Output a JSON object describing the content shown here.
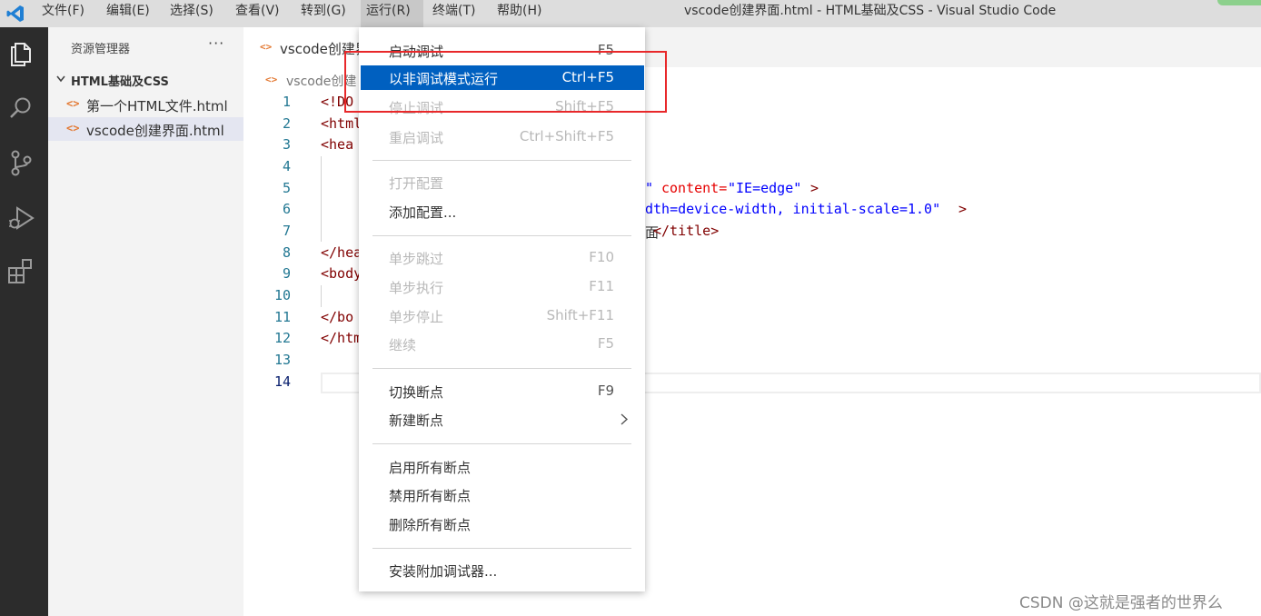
{
  "window": {
    "title": "vscode创建界面.html - HTML基础及CSS - Visual Studio Code"
  },
  "menubar": {
    "items": [
      {
        "label": "文件(F)"
      },
      {
        "label": "编辑(E)"
      },
      {
        "label": "选择(S)"
      },
      {
        "label": "查看(V)"
      },
      {
        "label": "转到(G)"
      },
      {
        "label": "运行(R)"
      },
      {
        "label": "终端(T)"
      },
      {
        "label": "帮助(H)"
      }
    ]
  },
  "activitybar": {
    "icons": [
      "files-icon",
      "search-icon",
      "source-control-icon",
      "run-debug-icon",
      "extensions-icon"
    ]
  },
  "sidebar": {
    "title": "资源管理器",
    "more": "···",
    "folder": "HTML基础及CSS",
    "files": [
      {
        "name": "第一个HTML文件.html",
        "icon": "<>"
      },
      {
        "name": "vscode创建界面.html",
        "icon": "<>"
      }
    ]
  },
  "editor": {
    "tab_label": "vscode创建界",
    "tab_icon": "<>",
    "breadcrumb_label": "vscode创建",
    "breadcrumb_icon": "<>",
    "line_numbers": [
      "1",
      "2",
      "3",
      "4",
      "5",
      "6",
      "7",
      "8",
      "9",
      "10",
      "11",
      "12",
      "13",
      "14"
    ],
    "code": {
      "l1": "<!DO",
      "l2": "<html",
      "l3": "<hea",
      "l5_quote": "\"",
      "l5_attr": "content=",
      "l5_val": "\"IE=edge\"",
      "l5_end": ">",
      "l6_val": "dth=device-width, initial-scale=1.0\"",
      "l6_end": ">",
      "l7_char": "面",
      "l7_end": "</title>",
      "l8": "</hea",
      "l9": "<body",
      "l11": "</bo",
      "l12": "</htm"
    }
  },
  "run_menu": {
    "items": [
      {
        "label": "启动调试",
        "shortcut": "F5",
        "state": "normal"
      },
      {
        "label": "以非调试模式运行",
        "shortcut": "Ctrl+F5",
        "state": "highlighted"
      },
      {
        "label": "停止调试",
        "shortcut": "Shift+F5",
        "state": "disabled"
      },
      {
        "label": "重启调试",
        "shortcut": "Ctrl+Shift+F5",
        "state": "disabled"
      },
      {
        "label": "打开配置",
        "shortcut": "",
        "state": "disabled"
      },
      {
        "label": "添加配置...",
        "shortcut": "",
        "state": "normal"
      },
      {
        "label": "单步跳过",
        "shortcut": "F10",
        "state": "disabled"
      },
      {
        "label": "单步执行",
        "shortcut": "F11",
        "state": "disabled"
      },
      {
        "label": "单步停止",
        "shortcut": "Shift+F11",
        "state": "disabled"
      },
      {
        "label": "继续",
        "shortcut": "F5",
        "state": "disabled"
      },
      {
        "label": "切换断点",
        "shortcut": "F9",
        "state": "normal"
      },
      {
        "label": "新建断点",
        "shortcut": "",
        "state": "normal",
        "submenu": true
      },
      {
        "label": "启用所有断点",
        "shortcut": "",
        "state": "normal"
      },
      {
        "label": "禁用所有断点",
        "shortcut": "",
        "state": "normal"
      },
      {
        "label": "删除所有断点",
        "shortcut": "",
        "state": "normal"
      },
      {
        "label": "安装附加调试器...",
        "shortcut": "",
        "state": "normal"
      }
    ]
  },
  "watermark": "CSDN @这就是强者的世界么",
  "colors": {
    "accent": "#0060c0",
    "highlight_box": "#e8282a",
    "activitybar": "#2c2c2c",
    "sidebar": "#f3f3f3"
  }
}
